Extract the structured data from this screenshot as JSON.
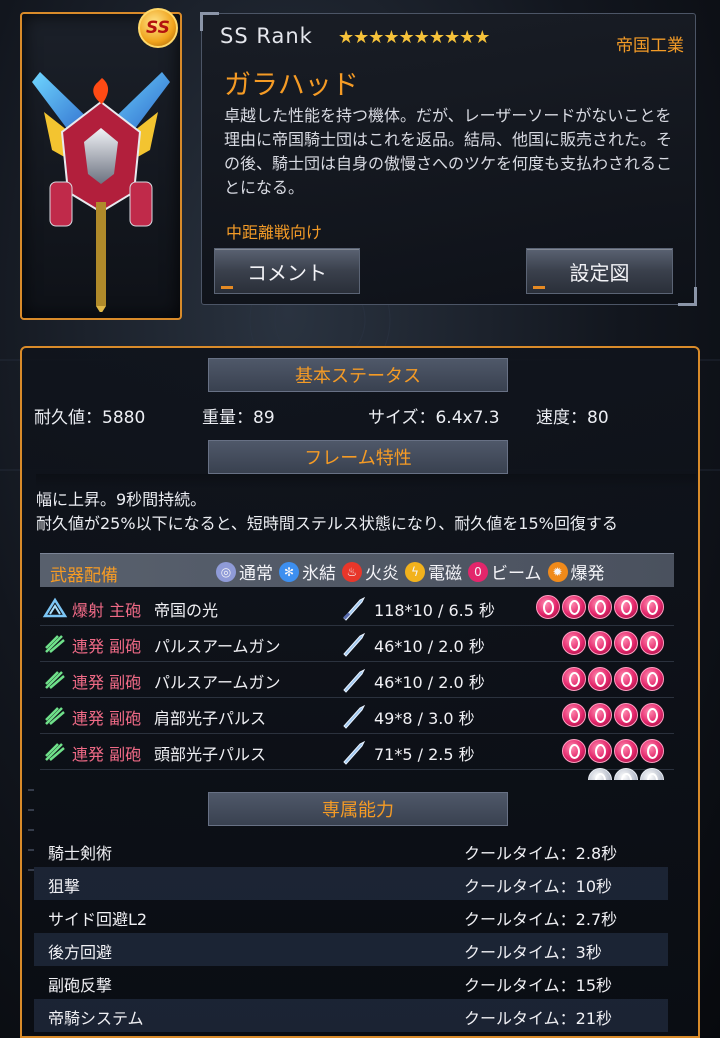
{
  "card": {
    "rank_badge": "SS",
    "rank_text": "SS Rank",
    "stars": "★★★★★★★★★★",
    "maker": "帝国工業",
    "ship_name": "ガラハッド",
    "description": "卓越した性能を持つ機体。だが、レーザーソードがないことを理由に帝国騎士団はこれを返品。結局、他国に販売された。その後、騎士団は自身の傲慢さへのツケを何度も支払わされることになる。",
    "role": "中距離戦向け",
    "comment_button": "コメント",
    "blueprint_button": "設定図"
  },
  "basic": {
    "header": "基本ステータス",
    "durability": "耐久値：5880",
    "weight": "重量：89",
    "size": "サイズ：6.4x7.3",
    "speed": "速度：80"
  },
  "frame": {
    "header": "フレーム特性",
    "line1": "幅に上昇。9秒間持続。",
    "line2": "耐久値が25%以下になると、短時間ステルス状態になり、耐久値を15%回復する"
  },
  "weapons": {
    "header": "武器配備",
    "legend": [
      {
        "label": "通常",
        "icon": "normal-icon",
        "color": "#8f9bd8"
      },
      {
        "label": "氷結",
        "icon": "frost-icon",
        "color": "#3d8ff0"
      },
      {
        "label": "火炎",
        "icon": "flame-icon",
        "color": "#e8362a"
      },
      {
        "label": "電磁",
        "icon": "lightning-icon",
        "color": "#f2b21c"
      },
      {
        "label": "ビーム",
        "icon": "beam-icon",
        "color": "#e3266b"
      },
      {
        "label": "爆発",
        "icon": "explosion-icon",
        "color": "#f08a1a"
      }
    ],
    "rows": [
      {
        "type": "爆射 主砲",
        "name": "帝国の光",
        "damage": "118*10  / 6.5 秒",
        "ammo": 5,
        "type_icon": "burst-main-icon"
      },
      {
        "type": "連発 副砲",
        "name": "パルスアームガン",
        "damage": "46*10  / 2.0 秒",
        "ammo": 4,
        "type_icon": "rapid-sub-icon"
      },
      {
        "type": "連発 副砲",
        "name": "パルスアームガン",
        "damage": "46*10  / 2.0 秒",
        "ammo": 4,
        "type_icon": "rapid-sub-icon"
      },
      {
        "type": "連発 副砲",
        "name": "肩部光子パルス",
        "damage": "49*8  / 3.0 秒",
        "ammo": 4,
        "type_icon": "rapid-sub-icon"
      },
      {
        "type": "連発 副砲",
        "name": "頭部光子パルス",
        "damage": "71*5  / 2.5 秒",
        "ammo": 4,
        "type_icon": "rapid-sub-icon"
      }
    ]
  },
  "abilities": {
    "header": "専属能力",
    "rows": [
      {
        "name": "騎士剣術",
        "cooldown": "クールタイム：2.8秒"
      },
      {
        "name": "狙撃",
        "cooldown": "クールタイム：10秒"
      },
      {
        "name": "サイド回避L2",
        "cooldown": "クールタイム：2.7秒"
      },
      {
        "name": "後方回避",
        "cooldown": "クールタイム：3秒"
      },
      {
        "name": "副砲反撃",
        "cooldown": "クールタイム：15秒"
      },
      {
        "name": "帝騎システム",
        "cooldown": "クールタイム：21秒"
      }
    ]
  },
  "colors": {
    "accent": "#f59b25",
    "frame_border": "#d98b2a",
    "beam": "#e3266b"
  }
}
